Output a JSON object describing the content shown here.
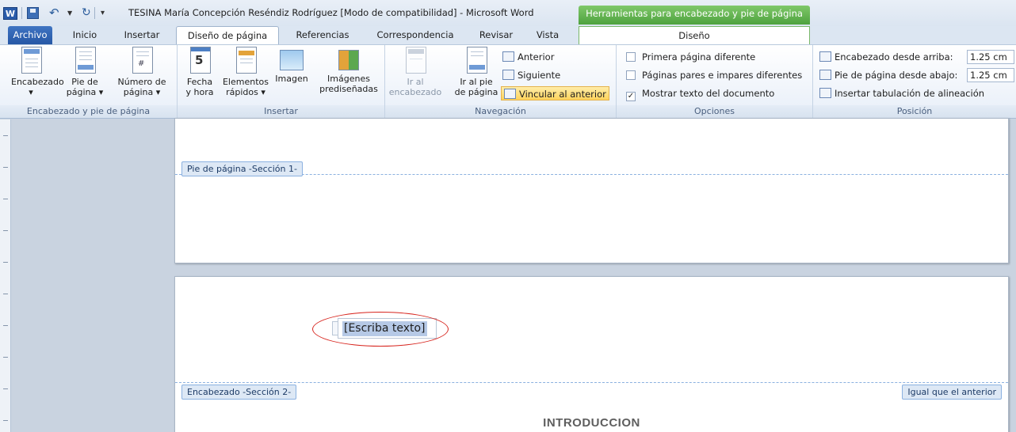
{
  "title_bar": {
    "title": "TESINA María Concepción Reséndiz Rodríguez [Modo de compatibilidad]  -  Microsoft Word",
    "context_tab_label": "Herramientas para encabezado y pie de página",
    "app_icon_letter": "W"
  },
  "tabs": {
    "archivo": "Archivo",
    "inicio": "Inicio",
    "insertar": "Insertar",
    "diseno_pagina": "Diseño de página",
    "referencias": "Referencias",
    "correspondencia": "Correspondencia",
    "revisar": "Revisar",
    "vista": "Vista",
    "diseno": "Diseño"
  },
  "ribbon": {
    "group_encabezado": {
      "label": "Encabezado y pie de página",
      "encabezado_line1": "Encabezado",
      "encabezado_line2": "▾",
      "pie_line1": "Pie de",
      "pie_line2": "página ▾",
      "numero_line1": "Número de",
      "numero_line2": "página ▾"
    },
    "group_insertar": {
      "label": "Insertar",
      "fecha_line1": "Fecha",
      "fecha_line2": "y hora",
      "elementos_line1": "Elementos",
      "elementos_line2": "rápidos ▾",
      "imagen_line1": "Imagen",
      "imagenes_line1": "Imágenes",
      "imagenes_line2": "prediseñadas"
    },
    "group_navegacion": {
      "label": "Navegación",
      "ir_encabezado_line1": "Ir al",
      "ir_encabezado_line2": "encabezado",
      "ir_pie_line1": "Ir al pie",
      "ir_pie_line2": "de página",
      "anterior": "Anterior",
      "siguiente": "Siguiente",
      "vincular": "Vincular al anterior"
    },
    "group_opciones": {
      "label": "Opciones",
      "primera": "Primera página diferente",
      "pares": "Páginas pares e impares diferentes",
      "mostrar": "Mostrar texto del documento",
      "mostrar_checked": "✓"
    },
    "group_posicion": {
      "label": "Posición",
      "encabezado_desde": "Encabezado desde arriba:",
      "encabezado_value": "1.25 cm",
      "pie_desde": "Pie de página desde abajo:",
      "pie_value": "1.25 cm",
      "tabulacion": "Insertar tabulación de alineación"
    }
  },
  "document": {
    "footer_tag": "Pie de página -Sección 1-",
    "header_tag": "Encabezado -Sección 2-",
    "same_as_previous": "Igual que el anterior",
    "placeholder_text": "[Escriba texto]",
    "heading": "INTRODUCCION"
  },
  "colors": {
    "context_green": "#4ea23e",
    "file_tab_blue": "#2657a5",
    "annotation_red": "#d7231c",
    "selection_blue": "#b6c9e6"
  }
}
